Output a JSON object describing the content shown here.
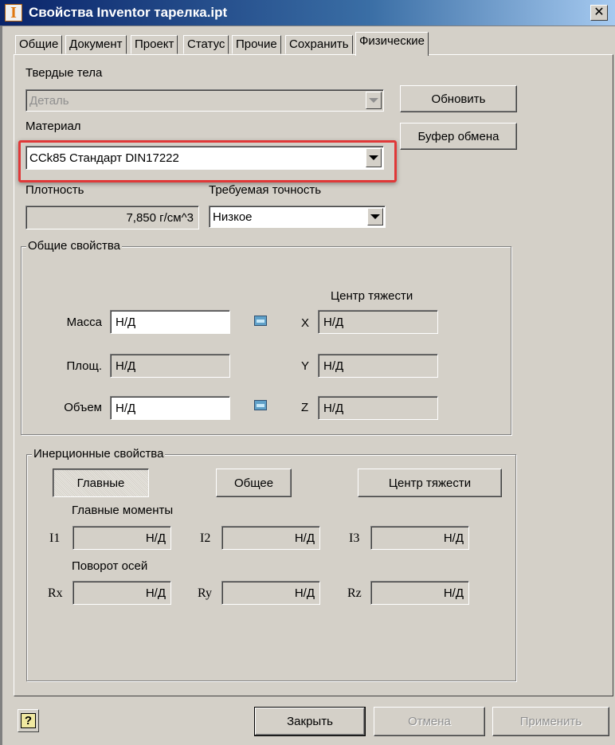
{
  "window": {
    "title": "Свойства Inventor тарелка.ipt",
    "app_icon_glyph": "I",
    "close_glyph": "✕"
  },
  "tabs": [
    {
      "label": "Общие"
    },
    {
      "label": "Документ"
    },
    {
      "label": "Проект"
    },
    {
      "label": "Статус"
    },
    {
      "label": "Прочие"
    },
    {
      "label": "Сохранить"
    },
    {
      "label": "Физические",
      "active": true
    }
  ],
  "solids": {
    "label": "Твердые тела",
    "value": "Деталь"
  },
  "material": {
    "label": "Материал",
    "value": "CCk85 Стандарт DIN17222"
  },
  "density": {
    "label": "Плотность",
    "value": "7,850 г/см^3"
  },
  "accuracy": {
    "label": "Требуемая точность",
    "value": "Низкое"
  },
  "buttons": {
    "update": "Обновить",
    "clipboard": "Буфер обмена",
    "close": "Закрыть",
    "cancel": "Отмена",
    "apply": "Применить",
    "help": "?"
  },
  "general_props": {
    "title": "Общие свойства",
    "mass_label": "Масса",
    "mass_value": "Н/Д",
    "area_label": "Площ.",
    "area_value": "Н/Д",
    "volume_label": "Объем",
    "volume_value": "Н/Д",
    "cg_title": "Центр тяжести",
    "x_label": "X",
    "x_value": "Н/Д",
    "y_label": "Y",
    "y_value": "Н/Д",
    "z_label": "Z",
    "z_value": "Н/Д"
  },
  "inertia": {
    "title": "Инерционные свойства",
    "btn_principal": "Главные",
    "btn_global": "Общее",
    "btn_cg": "Центр тяжести",
    "moments_title": "Главные моменты",
    "i1_label": "I1",
    "i1_value": "Н/Д",
    "i2_label": "I2",
    "i2_value": "Н/Д",
    "i3_label": "I3",
    "i3_value": "Н/Д",
    "rotation_title": "Поворот осей",
    "rx_label": "Rx",
    "rx_value": "Н/Д",
    "ry_label": "Ry",
    "ry_value": "Н/Д",
    "rz_label": "Rz",
    "rz_value": "Н/Д"
  },
  "colors": {
    "dialog_bg": "#d4d0c8",
    "title_bar": "#0a246a",
    "highlight": "#e03838"
  }
}
